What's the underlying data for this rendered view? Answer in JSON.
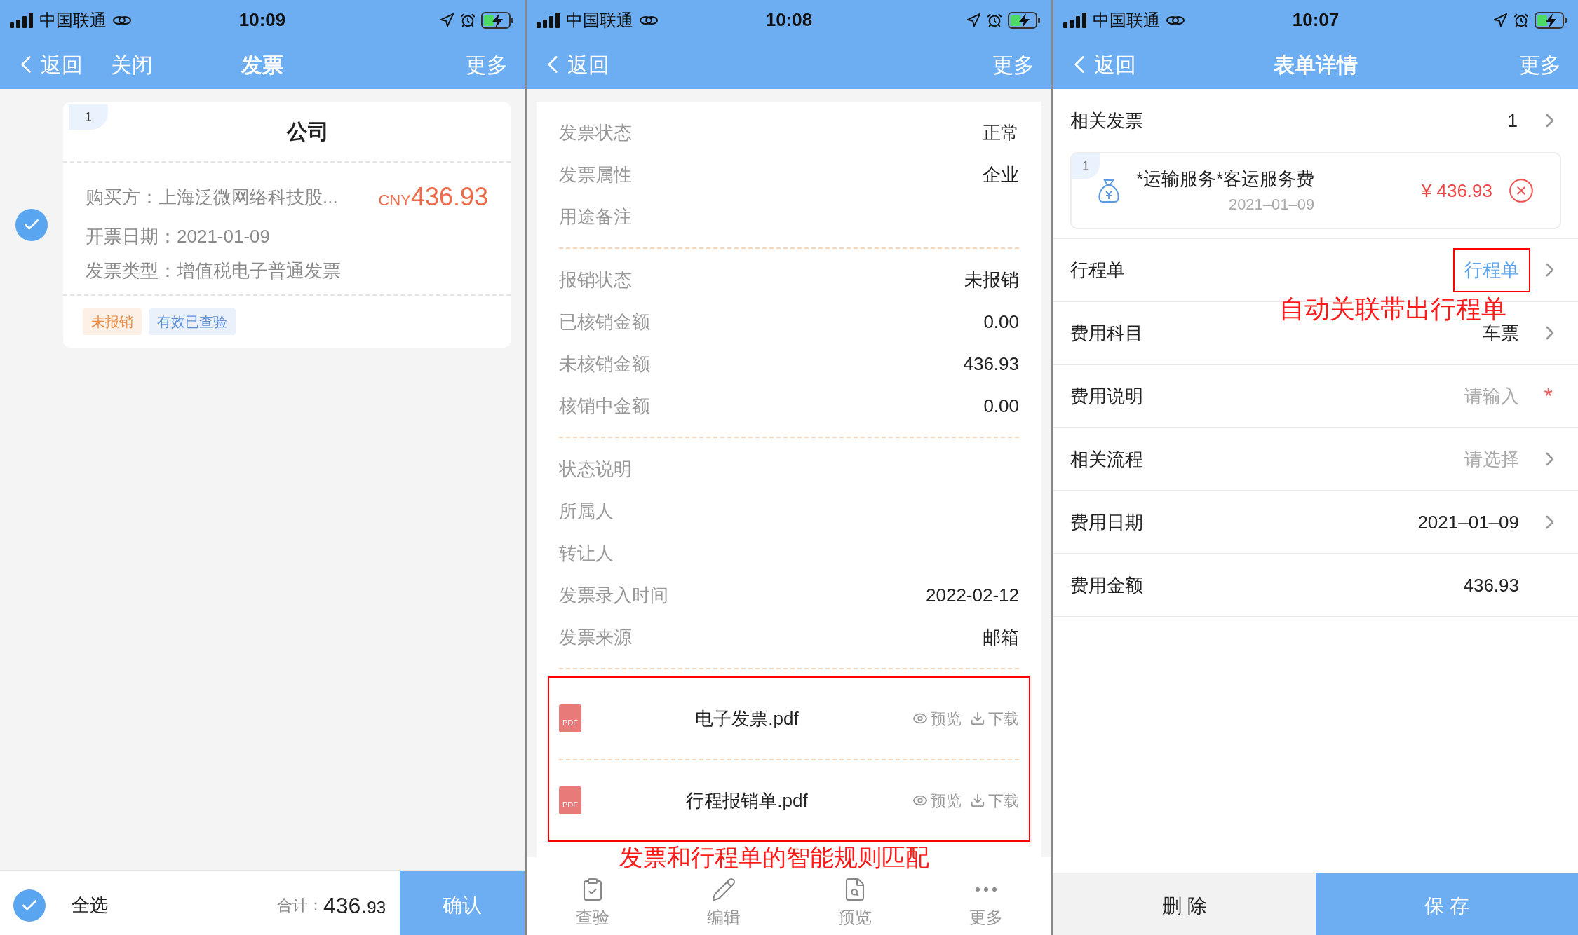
{
  "invoice_list_screen": {
    "status_bar": {
      "carrier": "中国联通",
      "time": "10:09"
    },
    "nav": {
      "back": "返回",
      "close": "关闭",
      "title": "发票",
      "more": "更多"
    },
    "invoice_card": {
      "index": "1",
      "title": "公司",
      "buyer": "购买方：上海泛微网络科技股...",
      "currency": "CNY",
      "amount": "436.93",
      "date": "开票日期：2021-01-09",
      "type": "发票类型：增值税电子普通发票",
      "selected": true,
      "tags": [
        {
          "label": "未报销",
          "color": "#f08a3c"
        },
        {
          "label": "有效已查验",
          "color": "#5b8fd9"
        }
      ]
    },
    "footer": {
      "select_all": "全选",
      "checked": true,
      "total_label": "合计：",
      "total_main": "436.",
      "total_minor": "93",
      "confirm": "确认"
    }
  },
  "invoice_detail_screen": {
    "status_bar": {
      "carrier": "中国联通",
      "time": "10:08"
    },
    "nav": {
      "back": "返回",
      "more": "更多"
    },
    "groups": [
      [
        {
          "label": "发票状态",
          "value": "正常"
        },
        {
          "label": "发票属性",
          "value": "企业"
        },
        {
          "label": "用途备注"
        }
      ],
      [
        {
          "label": "报销状态",
          "value": "未报销"
        },
        {
          "label": "已核销金额",
          "value": "0.00"
        },
        {
          "label": "未核销金额",
          "value": "436.93"
        },
        {
          "label": "核销中金额",
          "value": "0.00"
        }
      ],
      [
        {
          "label": "状态说明"
        },
        {
          "label": "所属人"
        },
        {
          "label": "转让人"
        },
        {
          "label": "发票录入时间",
          "value": "2022-02-12"
        },
        {
          "label": "发票来源",
          "value": "邮箱"
        }
      ]
    ],
    "files": [
      {
        "badge": "PDF",
        "name": "电子发票.pdf",
        "preview": "预览",
        "download": "下载"
      },
      {
        "badge": "PDF",
        "name": "行程报销单.pdf",
        "preview": "预览",
        "download": "下载"
      }
    ],
    "files_highlighted": true,
    "annotation": "发票和行程单的智能规则匹配",
    "toolbar": [
      {
        "kind": "verify",
        "label": "查验"
      },
      {
        "kind": "edit",
        "label": "编辑"
      },
      {
        "kind": "preview",
        "label": "预览"
      },
      {
        "kind": "more",
        "label": "更多"
      }
    ]
  },
  "form_detail_screen": {
    "status_bar": {
      "carrier": "中国联通",
      "time": "10:07"
    },
    "nav": {
      "back": "返回",
      "title": "表单详情",
      "more": "更多"
    },
    "related_invoice": {
      "label": "相关发票",
      "value": "1"
    },
    "invoice": {
      "index": "1",
      "name": "*运输服务*客运服务费",
      "date": "2021–01–09",
      "amount": "¥ 436.93"
    },
    "rows": [
      {
        "label": "行程单",
        "kind": "link",
        "value": "行程单",
        "chevron": true,
        "highlighted": true
      },
      {
        "label": "费用科目",
        "kind": "value",
        "value": "车票",
        "chevron": true,
        "highlighted": false
      },
      {
        "label": "费用说明",
        "kind": "input",
        "placeholder": "请输入",
        "required_mark": "*",
        "chevron": false,
        "highlighted": false
      },
      {
        "label": "相关流程",
        "kind": "select",
        "placeholder": "请选择",
        "chevron": true,
        "highlighted": false
      },
      {
        "label": "费用日期",
        "kind": "value",
        "value": "2021–01–09",
        "chevron": true,
        "highlighted": false
      },
      {
        "label": "费用金额",
        "kind": "value",
        "value": "436.93",
        "chevron": false,
        "highlighted": false
      }
    ],
    "annotation": "自动关联带出行程单",
    "buttons": [
      {
        "kind": "secondary",
        "label": "删 除"
      },
      {
        "kind": "primary",
        "label": "保 存"
      }
    ]
  }
}
